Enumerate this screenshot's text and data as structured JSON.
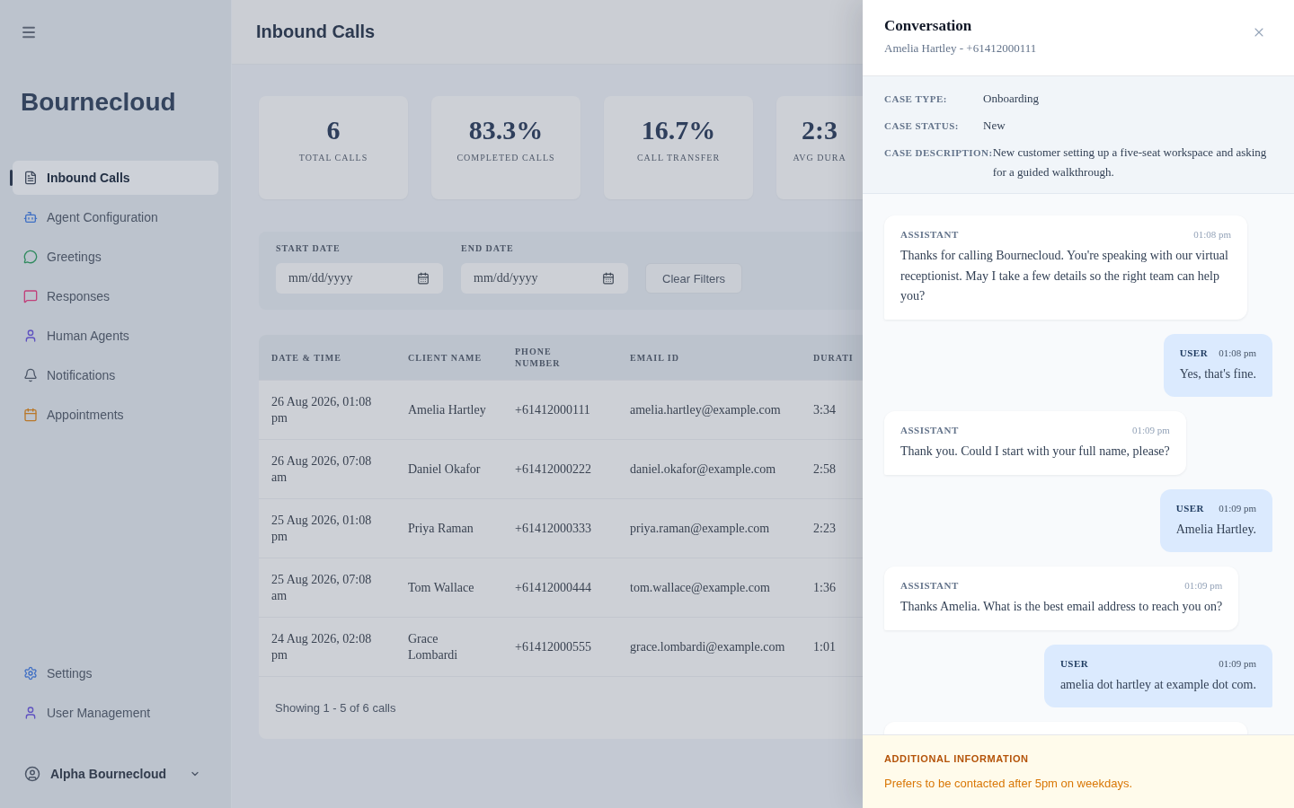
{
  "sidebar": {
    "brand": "Bournecloud",
    "nav_items": [
      {
        "label": "Inbound Calls",
        "selected": true
      },
      {
        "label": "Agent Configuration",
        "selected": false
      },
      {
        "label": "Greetings",
        "selected": false
      },
      {
        "label": "Responses",
        "selected": false
      },
      {
        "label": "Human Agents",
        "selected": false
      },
      {
        "label": "Notifications",
        "selected": false
      },
      {
        "label": "Appointments",
        "selected": false
      }
    ],
    "bottom_items": [
      {
        "label": "Settings",
        "selected": false
      },
      {
        "label": "User Management",
        "selected": false
      }
    ],
    "account": {
      "name": "Alpha Bournecloud"
    }
  },
  "header": {
    "title": "Inbound Calls"
  },
  "stats": [
    {
      "value": "6",
      "label": "TOTAL CALLS"
    },
    {
      "value": "83.3%",
      "label": "COMPLETED CALLS"
    },
    {
      "value": "16.7%",
      "label": "CALL TRANSFER"
    },
    {
      "value": "2:3",
      "label": "AVG DURA"
    }
  ],
  "filters": {
    "start_date": {
      "label": "START DATE",
      "placeholder": "mm/dd/yyyy"
    },
    "end_date": {
      "label": "END DATE",
      "placeholder": "mm/dd/yyyy"
    },
    "clear_button": "Clear Filters"
  },
  "table": {
    "columns": [
      "DATE & TIME",
      "CLIENT NAME",
      "PHONE NUMBER",
      "EMAIL ID",
      "DURATI"
    ],
    "rows": [
      [
        "26 Aug 2026, 01:08 pm",
        "Amelia Hartley",
        "+61412000111",
        "amelia.hartley@example.com",
        "3:34"
      ],
      [
        "26 Aug 2026, 07:08 am",
        "Daniel Okafor",
        "+61412000222",
        "daniel.okafor@example.com",
        "2:58"
      ],
      [
        "25 Aug 2026, 01:08 pm",
        "Priya Raman",
        "+61412000333",
        "priya.raman@example.com",
        "2:23"
      ],
      [
        "25 Aug 2026, 07:08 am",
        "Tom Wallace",
        "+61412000444",
        "tom.wallace@example.com",
        "1:36"
      ],
      [
        "24 Aug 2026, 02:08 pm",
        "Grace Lombardi",
        "+61412000555",
        "grace.lombardi@example.com",
        "1:01"
      ]
    ],
    "footer": "Showing 1 - 5 of 6 calls"
  },
  "conversation": {
    "title": "Conversation",
    "subtitle": "Amelia Hartley - +61412000111",
    "case": [
      {
        "label": "CASE TYPE:",
        "value": "Onboarding"
      },
      {
        "label": "CASE STATUS:",
        "value": "New"
      },
      {
        "label": "CASE DESCRIPTION:",
        "value": "New customer setting up a five-seat workspace and asking for a guided walkthrough."
      }
    ],
    "messages": [
      {
        "kind": "assistant",
        "role": "ASSISTANT",
        "time": "01:08 pm",
        "text": "Thanks for calling Bournecloud. You're speaking with our virtual receptionist. May I take a few details so the right team can help you?"
      },
      {
        "kind": "user",
        "role": "USER",
        "time": "01:08 pm",
        "text": "Yes, that's fine."
      },
      {
        "kind": "assistant",
        "role": "ASSISTANT",
        "time": "01:09 pm",
        "text": "Thank you. Could I start with your full name, please?"
      },
      {
        "kind": "user",
        "role": "USER",
        "time": "01:09 pm",
        "text": "Amelia Hartley."
      },
      {
        "kind": "assistant",
        "role": "ASSISTANT",
        "time": "01:09 pm",
        "text": "Thanks Amelia. What is the best email address to reach you on?"
      },
      {
        "kind": "user",
        "role": "USER",
        "time": "01:09 pm",
        "text": "amelia dot hartley at example dot com."
      },
      {
        "kind": "assistant"
      }
    ],
    "additional_info": {
      "title": "ADDITIONAL INFORMATION",
      "text": "Prefers to be contacted after 5pm on weekdays."
    }
  }
}
